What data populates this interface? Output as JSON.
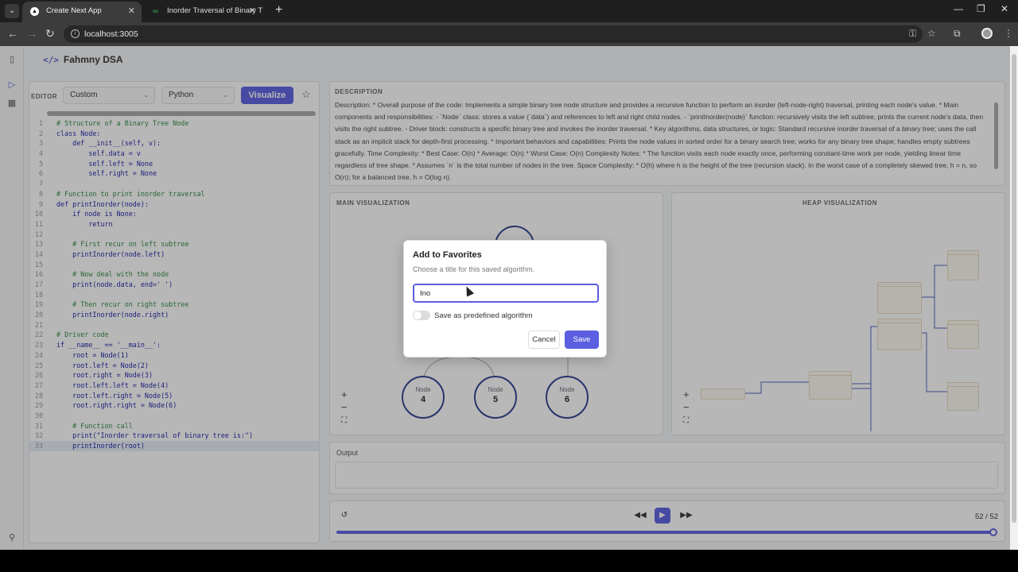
{
  "browser": {
    "tabs": [
      {
        "title": "Create Next App",
        "favicon": "nextjs-icon",
        "active": true
      },
      {
        "title": "Inorder Traversal of Binary Tree",
        "favicon": "gfg-icon",
        "active": false
      }
    ],
    "url": "localhost:3005"
  },
  "app": {
    "brand": "Fahmny DSA"
  },
  "editor": {
    "label": "EDITOR",
    "algorithm_select": "Custom",
    "language_select": "Python",
    "visualize_label": "Visualize",
    "lines": [
      {
        "n": "1",
        "text": "# Structure of a Binary Tree Node",
        "comment": true
      },
      {
        "n": "2",
        "text": "class Node:",
        "comment": false
      },
      {
        "n": "3",
        "text": "    def __init__(self, v):",
        "comment": false
      },
      {
        "n": "4",
        "text": "        self.data = v",
        "comment": false
      },
      {
        "n": "5",
        "text": "        self.left = None",
        "comment": false
      },
      {
        "n": "6",
        "text": "        self.right = None",
        "comment": false
      },
      {
        "n": "7",
        "text": "",
        "comment": false
      },
      {
        "n": "8",
        "text": "# Function to print inorder traversal",
        "comment": true
      },
      {
        "n": "9",
        "text": "def printInorder(node):",
        "comment": false
      },
      {
        "n": "10",
        "text": "    if node is None:",
        "comment": false
      },
      {
        "n": "11",
        "text": "        return",
        "comment": false
      },
      {
        "n": "12",
        "text": "",
        "comment": false
      },
      {
        "n": "13",
        "text": "    # First recur on left subtree",
        "comment": true
      },
      {
        "n": "14",
        "text": "    printInorder(node.left)",
        "comment": false
      },
      {
        "n": "15",
        "text": "",
        "comment": false
      },
      {
        "n": "16",
        "text": "    # Now deal with the node",
        "comment": true
      },
      {
        "n": "17",
        "text": "    print(node.data, end=' ')",
        "comment": false
      },
      {
        "n": "18",
        "text": "",
        "comment": false
      },
      {
        "n": "19",
        "text": "    # Then recur on right subtree",
        "comment": true
      },
      {
        "n": "20",
        "text": "    printInorder(node.right)",
        "comment": false
      },
      {
        "n": "21",
        "text": "",
        "comment": false
      },
      {
        "n": "22",
        "text": "# Driver code",
        "comment": true
      },
      {
        "n": "23",
        "text": "if __name__ == '__main__':",
        "comment": false
      },
      {
        "n": "24",
        "text": "    root = Node(1)",
        "comment": false
      },
      {
        "n": "25",
        "text": "    root.left = Node(2)",
        "comment": false
      },
      {
        "n": "26",
        "text": "    root.right = Node(3)",
        "comment": false
      },
      {
        "n": "27",
        "text": "    root.left.left = Node(4)",
        "comment": false
      },
      {
        "n": "28",
        "text": "    root.left.right = Node(5)",
        "comment": false
      },
      {
        "n": "29",
        "text": "    root.right.right = Node(6)",
        "comment": false
      },
      {
        "n": "30",
        "text": "",
        "comment": false
      },
      {
        "n": "31",
        "text": "    # Function call",
        "comment": true
      },
      {
        "n": "32",
        "text": "    print(\"Inorder traversal of binary tree is:\")",
        "comment": false
      },
      {
        "n": "33",
        "text": "    printInorder(root)",
        "comment": false
      }
    ]
  },
  "description": {
    "label": "DESCRIPTION",
    "text": "Description: * Overall purpose of the code: Implements a simple binary tree node structure and provides a recursive function to perform an inorder (left-node-right) traversal, printing each node's value. * Main components and responsibilities: - `Node` class: stores a value (`data`) and references to left and right child nodes. - `printInorder(node)` function: recursively visits the left subtree, prints the current node's data, then visits the right subtree. - Driver block: constructs a specific binary tree and invokes the inorder traversal. * Key algorithms, data structures, or logic: Standard recursive inorder traversal of a binary tree; uses the call stack as an implicit stack for depth-first processing. * Important behaviors and capabilities: Prints the node values in sorted order for a binary search tree; works for any binary tree shape; handles empty subtrees gracefully. Time Complexity: * Best Case: O(n) * Average: O(n) * Worst Case: O(n) Complexity Notes: * The function visits each node exactly once, performing constant-time work per node, yielding linear time regardless of tree shape. * Assumes `n` is the total number of nodes in the tree. Space Complexity: * O(h) where h is the height of the tree (recursion stack). In the worst case of a completely skewed tree, h = n, so O(n); for a balanced tree, h = O(log n)."
  },
  "main_viz": {
    "label": "MAIN VISUALIZATION",
    "nodes": [
      {
        "label": "Node",
        "value": "4"
      },
      {
        "label": "Node",
        "value": "5"
      },
      {
        "label": "Node",
        "value": "6"
      }
    ]
  },
  "heap_viz": {
    "label": "HEAP VISUALIZATION"
  },
  "output": {
    "label": "Output"
  },
  "player": {
    "step": "52 / 52",
    "progress_fraction": 1.0
  },
  "modal": {
    "title": "Add to Favorites",
    "subtitle": "Choose a title for this saved algorithm.",
    "input_value": "Ino",
    "toggle_label": "Save as predefined algorithm",
    "toggle_on": false,
    "cancel_label": "Cancel",
    "save_label": "Save"
  },
  "colors": {
    "accent": "#5b5fe0",
    "node_border": "#2b3e8f",
    "comment": "#2d8a3e",
    "code": "#1b1ba8"
  }
}
